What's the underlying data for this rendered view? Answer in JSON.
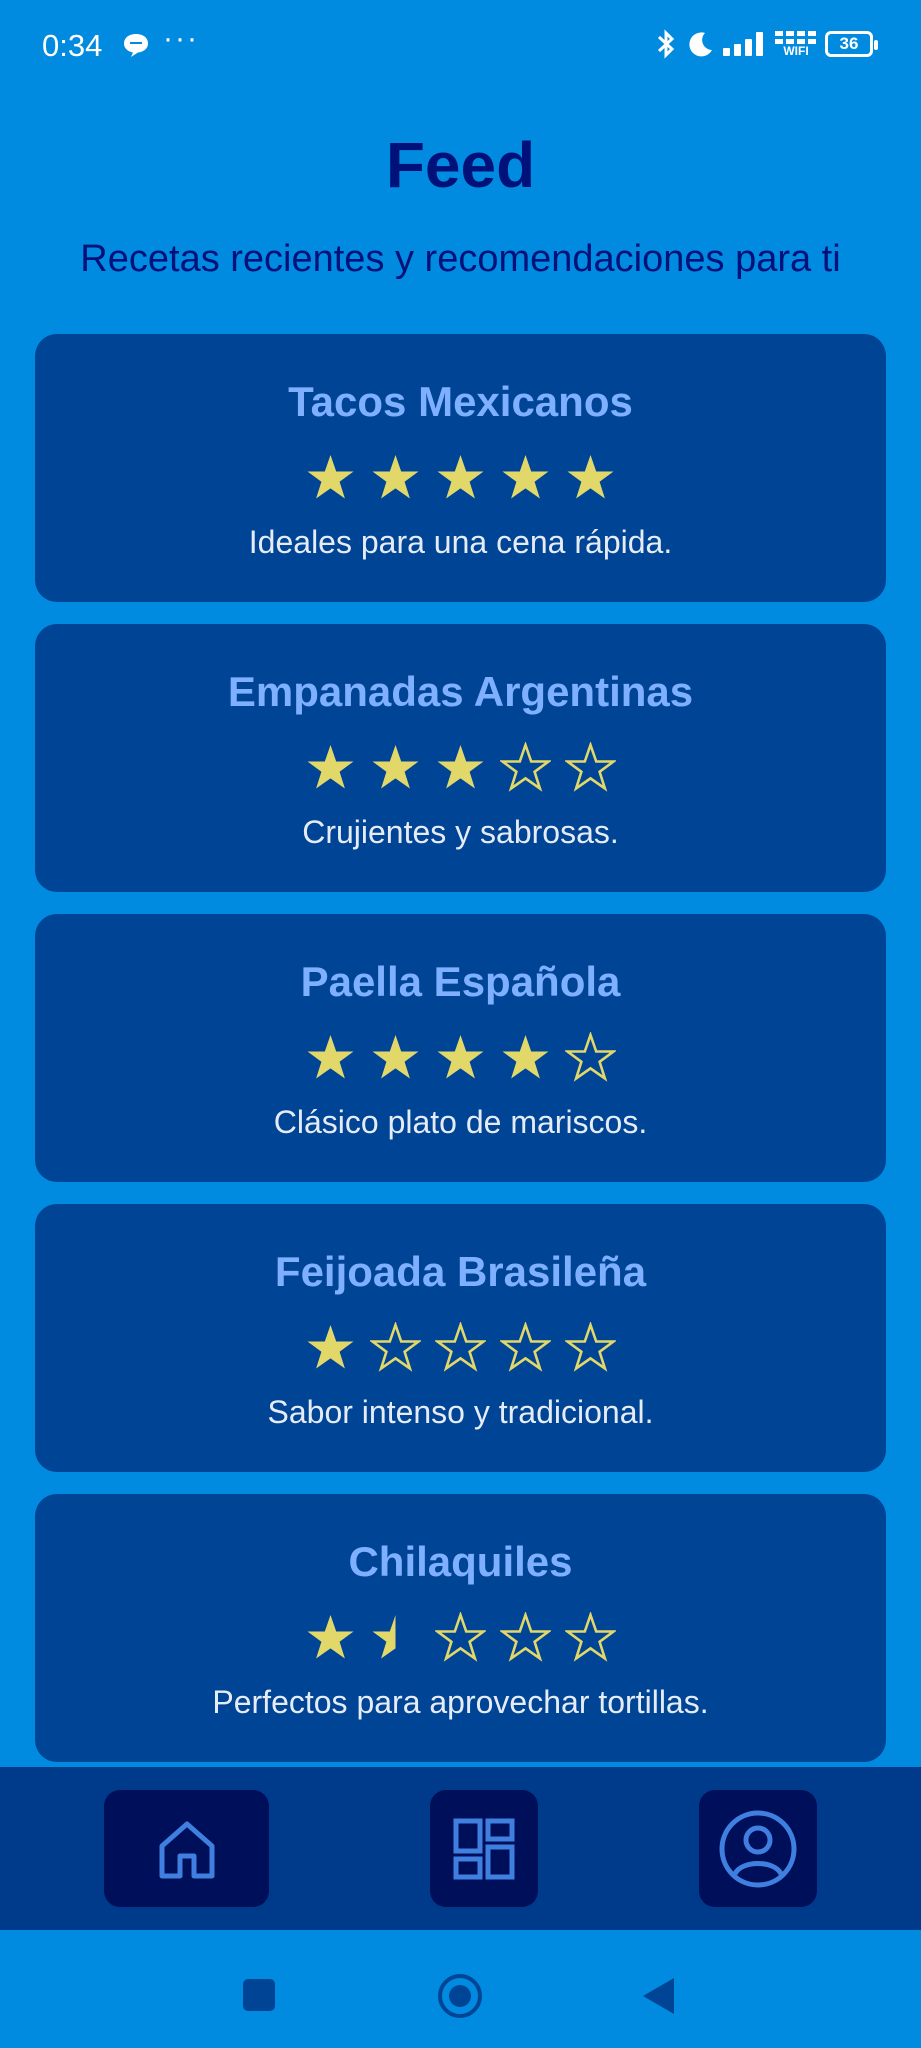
{
  "status_bar": {
    "time": "0:34",
    "dots": "···",
    "wifi_label": "WIFI",
    "battery": "36"
  },
  "header": {
    "title": "Feed",
    "subtitle": "Recetas recientes y recomendaciones para ti"
  },
  "colors": {
    "background": "#008be1",
    "card": "#004495",
    "title": "#00127a",
    "card_title": "#7fb0ff",
    "star": "#e2d86a",
    "nav_bar": "#003a8a",
    "nav_button": "#000f5a",
    "nav_icon": "#3f7fe0"
  },
  "recipes": [
    {
      "name": "Tacos Mexicanos",
      "rating": 5,
      "description": "Ideales para una cena rápida."
    },
    {
      "name": "Empanadas Argentinas",
      "rating": 3,
      "description": "Crujientes y sabrosas."
    },
    {
      "name": "Paella Española",
      "rating": 4,
      "description": "Clásico plato de mariscos."
    },
    {
      "name": "Feijoada Brasileña",
      "rating": 1,
      "description": "Sabor intenso y tradicional."
    },
    {
      "name": "Chilaquiles",
      "rating": 1.5,
      "description": "Perfectos para aprovechar tortillas."
    }
  ],
  "bottom_nav": {
    "items": [
      {
        "icon": "home-icon"
      },
      {
        "icon": "grid-icon"
      },
      {
        "icon": "profile-icon"
      }
    ]
  },
  "system_nav": {
    "items": [
      {
        "icon": "recents-square-icon"
      },
      {
        "icon": "home-circle-icon"
      },
      {
        "icon": "back-triangle-icon"
      }
    ]
  }
}
